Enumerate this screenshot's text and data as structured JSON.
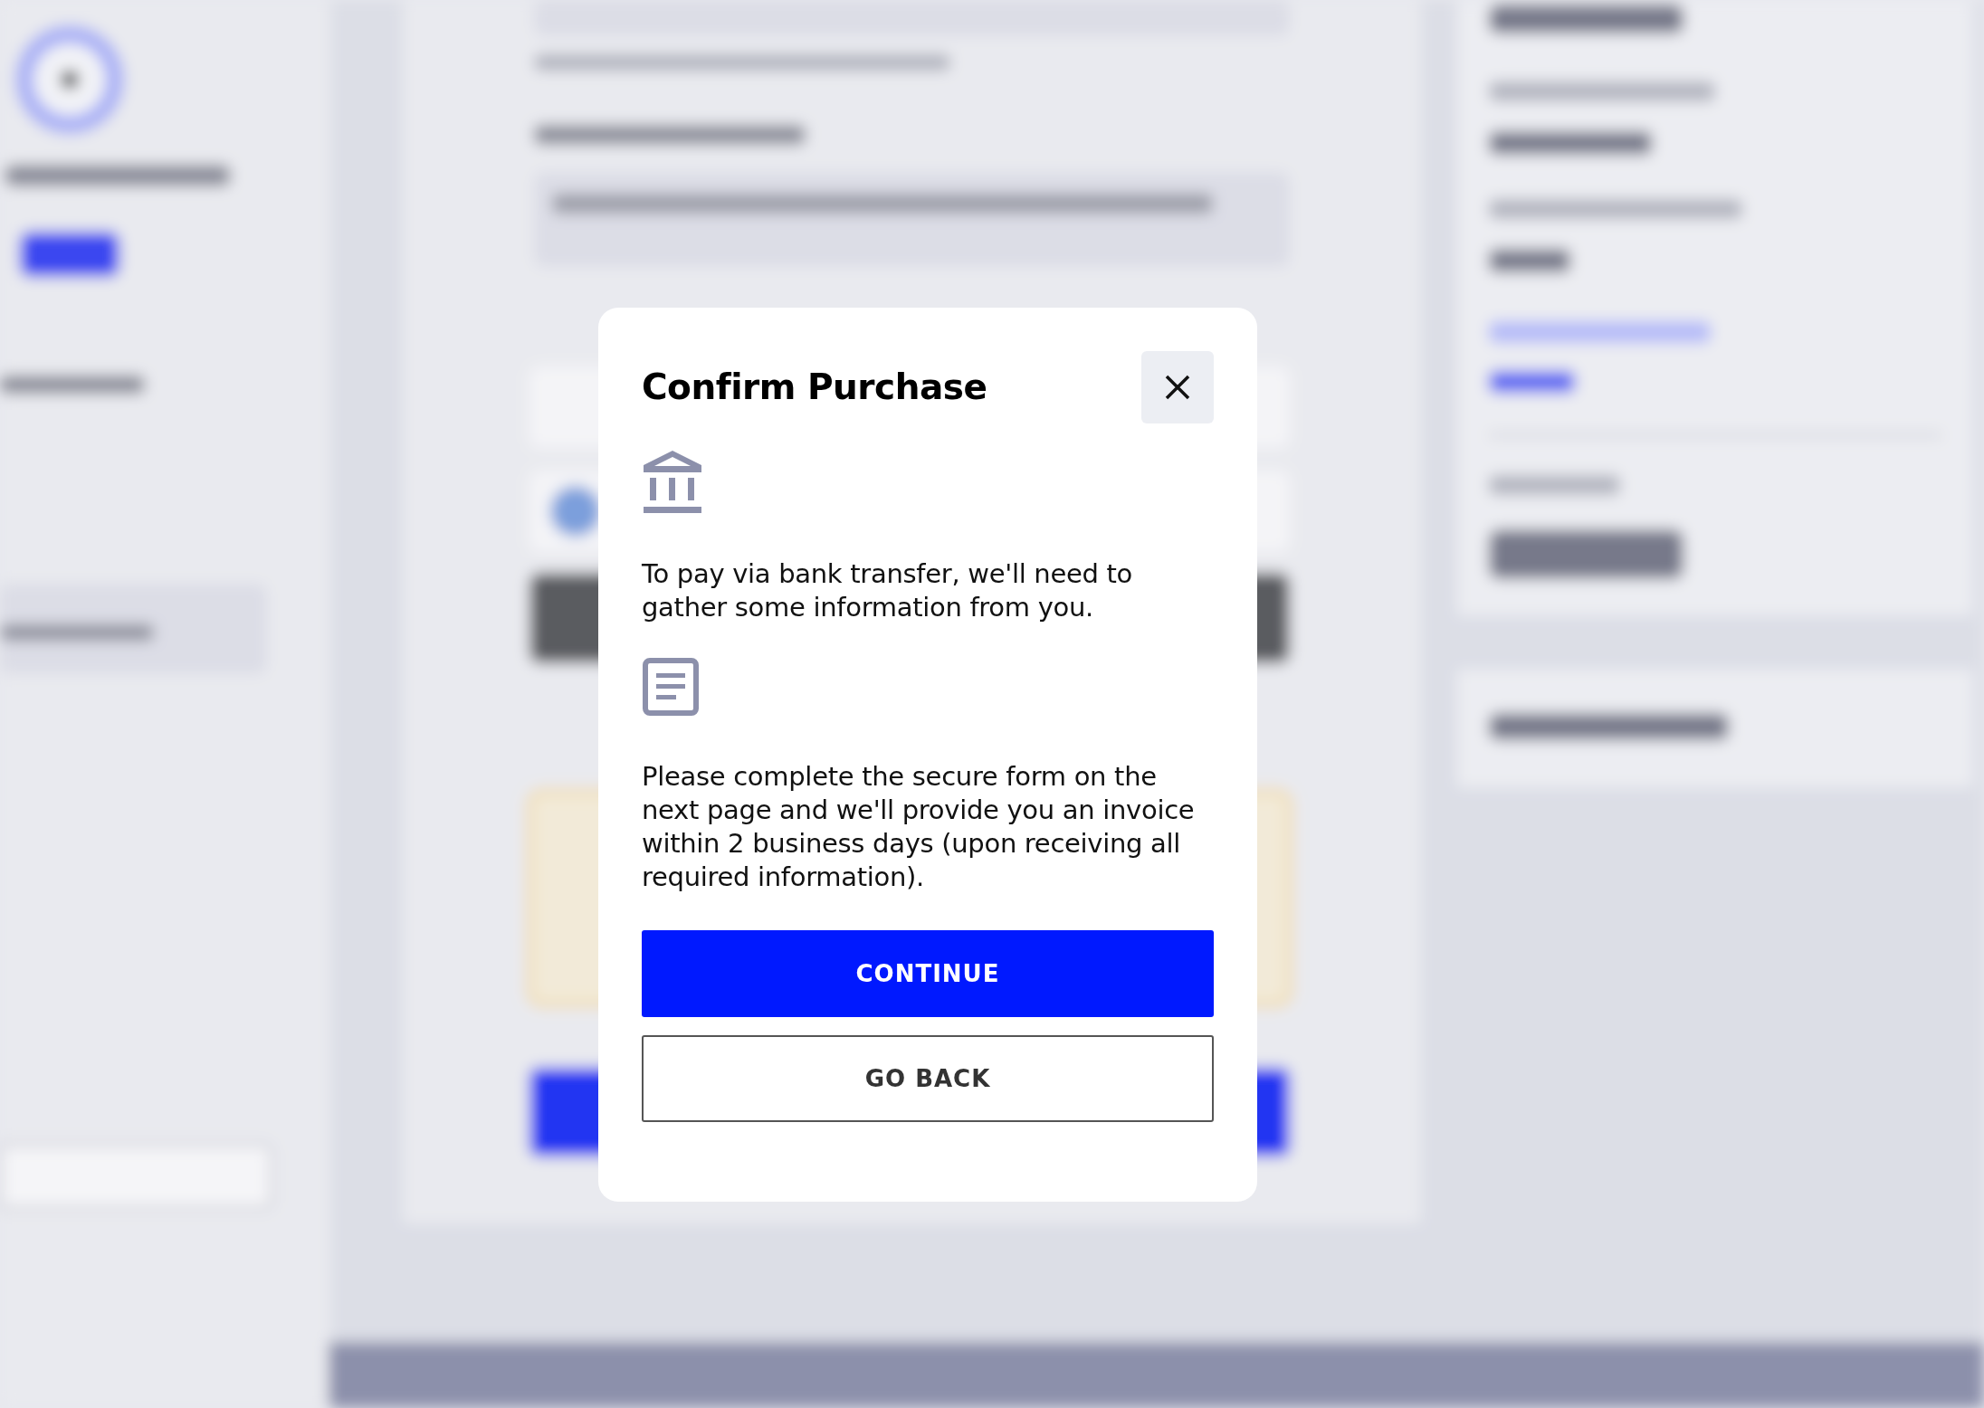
{
  "dialog": {
    "title": "Confirm Purchase",
    "steps": [
      {
        "kind": "bank",
        "text": "To pay via bank transfer, we'll need to gather some information from you."
      },
      {
        "kind": "form",
        "text": "Please complete the secure form on the next page and we'll provide you an invoice within 2 business days (upon receiving all required information)."
      }
    ],
    "buttons": [
      {
        "kind": "primary",
        "label": "CONTINUE"
      },
      {
        "kind": "outline",
        "label": "GO BACK"
      }
    ]
  }
}
